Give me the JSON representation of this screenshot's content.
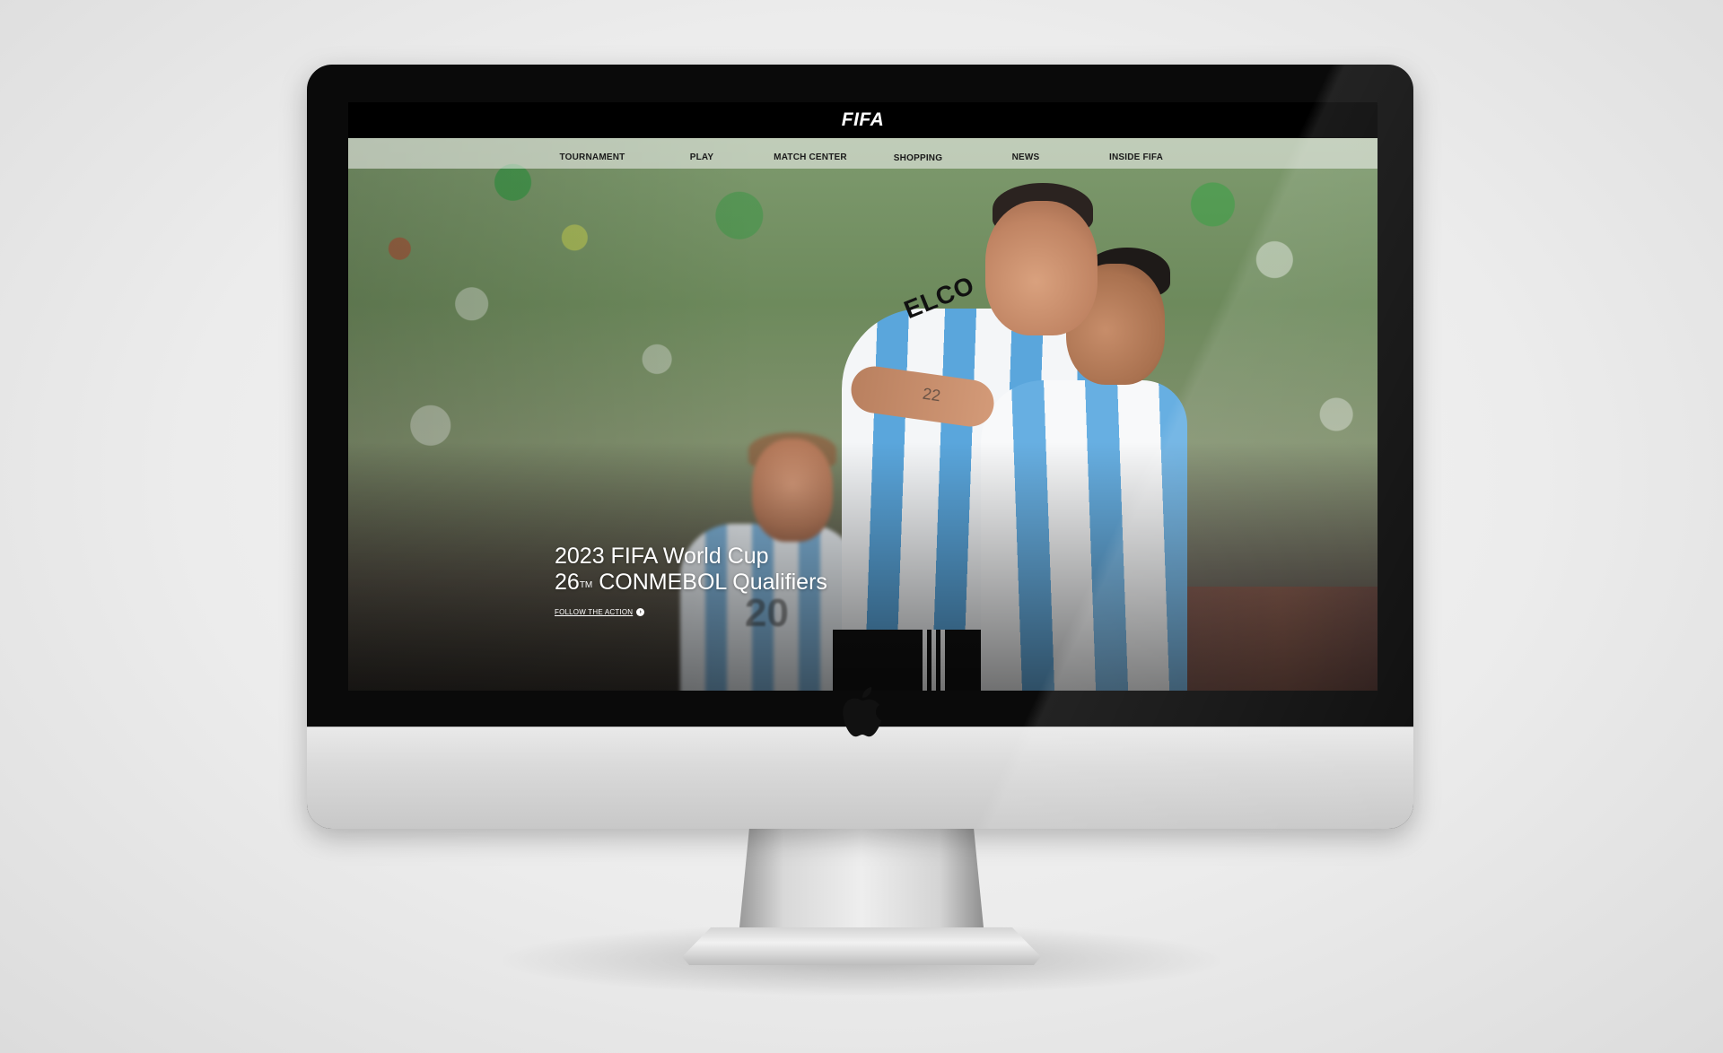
{
  "site": {
    "logo": "FIFA"
  },
  "nav": {
    "items": [
      {
        "label": "TOURNAMENT"
      },
      {
        "label": "PLAY"
      },
      {
        "label": "MATCH CENTER"
      },
      {
        "label": "SHOPPING"
      },
      {
        "label": "NEWS"
      },
      {
        "label": "INSIDE FIFA"
      }
    ]
  },
  "hero": {
    "title_line1": "2023 FIFA World Cup",
    "title_line2_prefix": "26",
    "title_line2_sup": "TM",
    "title_line2_suffix": " CONMEBOL Qualifiers",
    "cta_label": "FOLLOW THE ACTION",
    "cta_icon": "arrow-right-circle-icon",
    "jersey_name": "ELCO",
    "jersey_number": "20",
    "tattoo": "22"
  },
  "device": {
    "logo": "apple-logo"
  },
  "colors": {
    "header_bg": "#000000",
    "nav_text": "#1a1a1a",
    "hero_text": "#ffffff",
    "jersey_blue": "#5aa6dc"
  }
}
